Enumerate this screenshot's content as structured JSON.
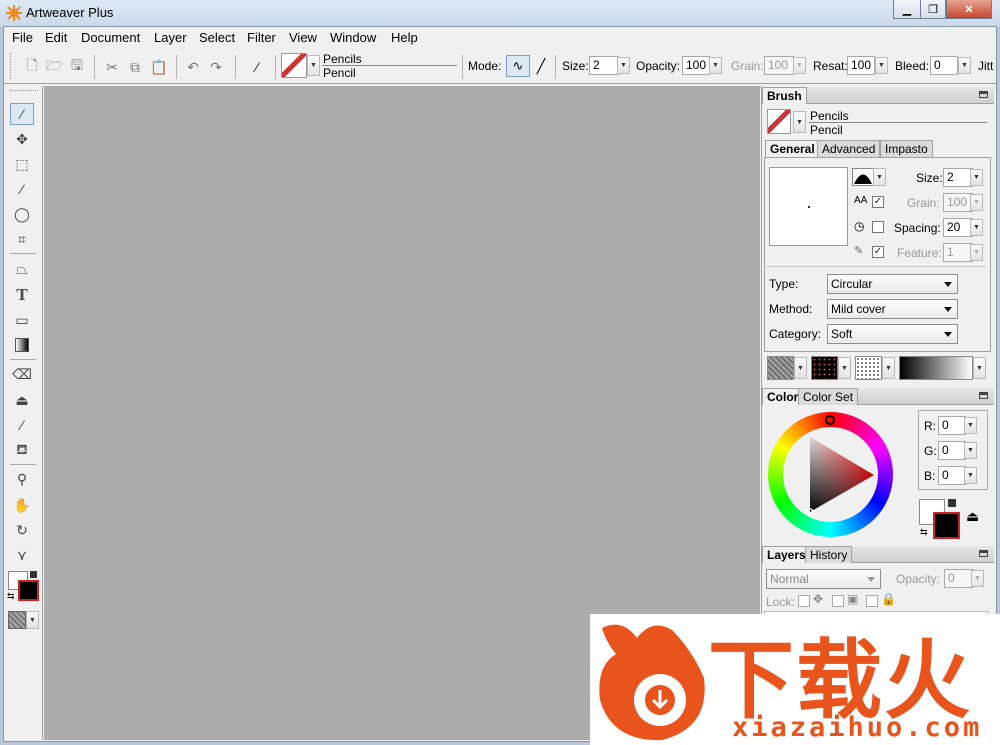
{
  "window": {
    "title": "Artweaver Plus",
    "controls": [
      "minimize",
      "restore",
      "close"
    ]
  },
  "menubar": [
    "File",
    "Edit",
    "Document",
    "Layer",
    "Select",
    "Filter",
    "View",
    "Window",
    "Help"
  ],
  "toolbar": {
    "brush_category": "Pencils",
    "brush_name": "Pencil",
    "mode_label": "Mode:",
    "size_label": "Size:",
    "size_value": "2",
    "opacity_label": "Opacity:",
    "opacity_value": "100",
    "grain_label": "Grain:",
    "grain_value": "100",
    "resat_label": "Resat:",
    "resat_value": "100",
    "bleed_label": "Bleed:",
    "bleed_value": "0",
    "jitter_label": "Jitt"
  },
  "brush_panel": {
    "title": "Brush",
    "category": "Pencils",
    "name": "Pencil",
    "tabs": [
      "General",
      "Advanced",
      "Impasto"
    ],
    "active_tab": "General",
    "size_label": "Size:",
    "size_value": "2",
    "grain_label": "Grain:",
    "grain_value": "100",
    "spacing_label": "Spacing:",
    "spacing_value": "20",
    "feature_label": "Feature:",
    "feature_value": "1",
    "type_label": "Type:",
    "type_value": "Circular",
    "method_label": "Method:",
    "method_value": "Mild cover",
    "category_label": "Category:",
    "category_value": "Soft"
  },
  "color_panel": {
    "tabs": [
      "Color",
      "Color Set"
    ],
    "active_tab": "Color",
    "r_label": "R:",
    "r_value": "0",
    "g_label": "G:",
    "g_value": "0",
    "b_label": "B:",
    "b_value": "0",
    "foreground": "#000000",
    "background": "#ffffff"
  },
  "layers_panel": {
    "tabs": [
      "Layers",
      "History"
    ],
    "active_tab": "Layers",
    "blend_mode": "Normal",
    "opacity_label": "Opacity:",
    "opacity_value": "0",
    "lock_label": "Lock:"
  },
  "watermark": {
    "brand_text": "下载火",
    "url": "xiazaihuo.com",
    "color": "#e8541c"
  }
}
